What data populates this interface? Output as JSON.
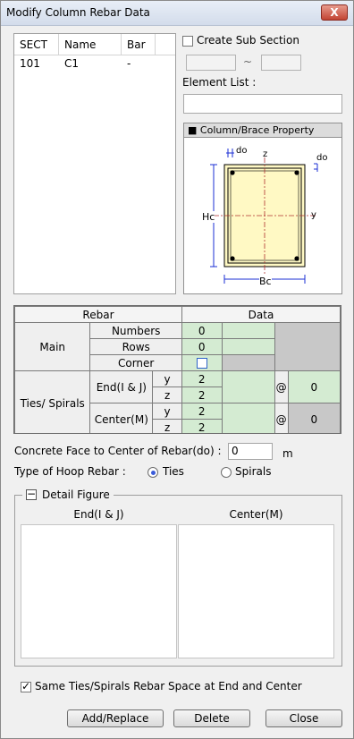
{
  "window": {
    "title": "Modify Column Rebar Data",
    "close_glyph": "X"
  },
  "section_list": {
    "headers": [
      "SECT",
      "Name",
      "Bar"
    ],
    "rows": [
      {
        "sect": "101",
        "name": "C1",
        "bar": "-"
      }
    ]
  },
  "sub_section": {
    "label": "Create Sub Section",
    "checked": false,
    "range_sep": "~"
  },
  "element_list": {
    "label": "Element List :",
    "value": ""
  },
  "property": {
    "title": "Column/Brace Property",
    "labels": {
      "do_top": "do",
      "do_right": "do",
      "z": "z",
      "y": "y",
      "hc": "Hc",
      "bc": "Bc"
    }
  },
  "rebar_table": {
    "headers": {
      "rebar": "Rebar",
      "data": "Data"
    },
    "main_label": "Main",
    "numbers_label": "Numbers",
    "rows_label": "Rows",
    "corner_label": "Corner",
    "numbers_value": "0",
    "rows_value": "0",
    "ties_label": "Ties/ Spirals",
    "end_label": "End(I & J)",
    "center_label": "Center(M)",
    "y_label": "y",
    "z_label": "z",
    "end_y": "2",
    "end_z": "2",
    "center_y": "2",
    "center_z": "2",
    "at": "@",
    "end_space": "0",
    "center_space": "0"
  },
  "concrete_face": {
    "label": "Concrete Face to Center of Rebar(do) :",
    "value": "0",
    "unit": "m"
  },
  "hoop": {
    "label": "Type of Hoop Rebar :",
    "ties": "Ties",
    "spirals": "Spirals",
    "selected": "Ties"
  },
  "detail": {
    "label": "Detail Figure",
    "end_header": "End(I & J)",
    "center_header": "Center(M)"
  },
  "same_space": {
    "label": "Same Ties/Spirals Rebar Space at End and Center",
    "checked": true
  },
  "buttons": {
    "add_replace": "Add/Replace",
    "delete": "Delete",
    "close": "Close"
  }
}
